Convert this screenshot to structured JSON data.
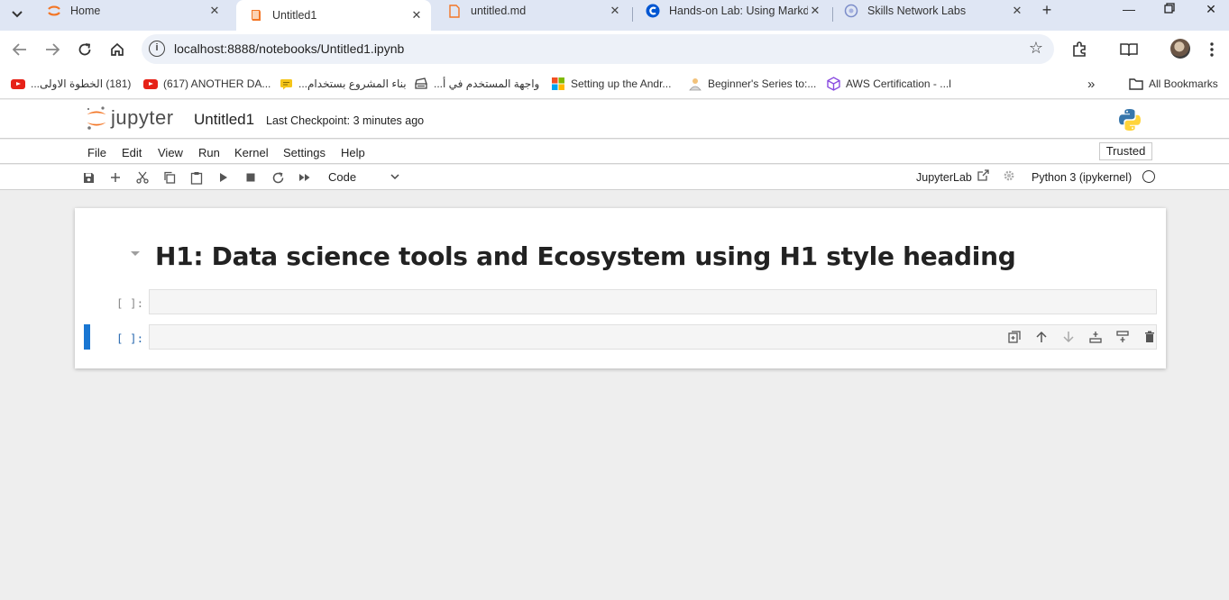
{
  "browser": {
    "tabs": [
      {
        "title": "Home",
        "icon": "jupyter-icon"
      },
      {
        "title": "Untitled1",
        "icon": "notebook-icon"
      },
      {
        "title": "untitled.md",
        "icon": "file-icon"
      },
      {
        "title": "Hands-on Lab: Using Markd",
        "icon": "coursera-icon"
      },
      {
        "title": "Skills Network Labs",
        "icon": "skills-network-icon"
      }
    ],
    "new_tab": "+",
    "url": "localhost:8888/notebooks/Untitled1.ipynb",
    "bookmarks": [
      {
        "label": "(181) الخطوة الاولى...",
        "icon": "youtube-icon"
      },
      {
        "label": "(617) ANOTHER DA...",
        "icon": "youtube-icon"
      },
      {
        "label": "بناء المشروع بستخدام...",
        "icon": "chat-icon"
      },
      {
        "label": "واجهة المستخدم في أ...",
        "icon": "print-icon"
      },
      {
        "label": "Setting up the Andr...",
        "icon": "microsoft-icon"
      },
      {
        "label": "Beginner's Series to:...",
        "icon": "person-icon"
      },
      {
        "label": "AWS Certification - ...l",
        "icon": "cube-icon"
      }
    ],
    "more_bookmarks": "»",
    "all_bookmarks": "All Bookmarks"
  },
  "jupyter": {
    "logo_text": "jupyter",
    "notebook_title": "Untitled1",
    "checkpoint": "Last Checkpoint: 3 minutes ago",
    "menu": [
      "File",
      "Edit",
      "View",
      "Run",
      "Kernel",
      "Settings",
      "Help"
    ],
    "trusted": "Trusted",
    "cell_type": "Code",
    "jupyterlab_link": "JupyterLab",
    "kernel_name": "Python 3 (ipykernel)",
    "colors": {
      "accent": "#1976d2",
      "jupyter_orange": "#f37626",
      "python_blue": "#3776ab",
      "python_yellow": "#ffd43b"
    }
  },
  "notebook": {
    "heading": "H1: Data science tools and Ecosystem using H1 style heading",
    "cells": [
      {
        "prompt": "[ ]:",
        "content": ""
      },
      {
        "prompt": "[ ]:",
        "content": ""
      }
    ]
  }
}
